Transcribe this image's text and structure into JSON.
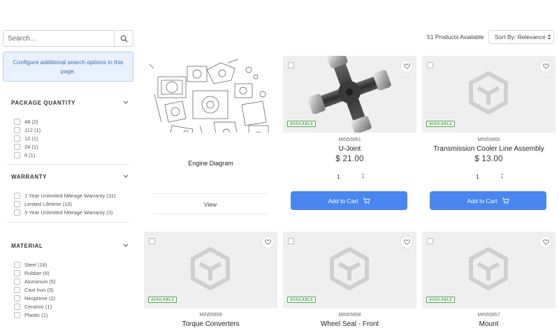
{
  "search": {
    "placeholder": "Search..."
  },
  "notice": {
    "text": "Configure additional search options in this page."
  },
  "facets": [
    {
      "title": "PACKAGE QUANTITY",
      "items": [
        {
          "label": "48",
          "count": "(2)"
        },
        {
          "label": "112",
          "count": "(1)"
        },
        {
          "label": "12",
          "count": "(1)"
        },
        {
          "label": "24",
          "count": "(1)"
        },
        {
          "label": "6",
          "count": "(1)"
        }
      ]
    },
    {
      "title": "WARRANTY",
      "items": [
        {
          "label": "1 Year Unlimited Mileage Warranty",
          "count": "(31)"
        },
        {
          "label": "Limited Lifetime",
          "count": "(10)"
        },
        {
          "label": "3 Year Unlimited Mileage Warranty",
          "count": "(3)"
        }
      ]
    },
    {
      "title": "MATERIAL",
      "items": [
        {
          "label": "Steel",
          "count": "(18)"
        },
        {
          "label": "Rubber",
          "count": "(6)"
        },
        {
          "label": "Aluminum",
          "count": "(5)"
        },
        {
          "label": "Cast Iron",
          "count": "(3)"
        },
        {
          "label": "Neoprene",
          "count": "(2)"
        },
        {
          "label": "Ceramic",
          "count": "(1)"
        },
        {
          "label": "Plastic",
          "count": "(1)"
        }
      ]
    }
  ],
  "results": {
    "count_text": "51 Products Available",
    "sort_label": "Sort By: Relevance"
  },
  "engine": {
    "name": "Engine Diagram",
    "link": "View"
  },
  "products": [
    {
      "sku": "MIN55861",
      "name": "U-Joint",
      "price": "$ 21.00",
      "qty": "1",
      "badge": "AVAILABLE",
      "button": "Add to Cart"
    },
    {
      "sku": "MIN55860",
      "name": "Transmission Cooler Line Assembly",
      "price": "$ 13.00",
      "qty": "1",
      "badge": "AVAILABLE",
      "button": "Add to Cart"
    },
    {
      "sku": "MIN55859",
      "name": "Torque Converters",
      "badge": "AVAILABLE"
    },
    {
      "sku": "MIN55858",
      "name": "Wheel Seal - Front",
      "badge": "AVAILABLE"
    },
    {
      "sku": "MIN55857",
      "name": "Mount",
      "badge": "AVAILABLE"
    }
  ],
  "colors": {
    "primary": "#4a86f0",
    "available": "#4aa84a",
    "notice_bg": "#e9f1fc"
  }
}
